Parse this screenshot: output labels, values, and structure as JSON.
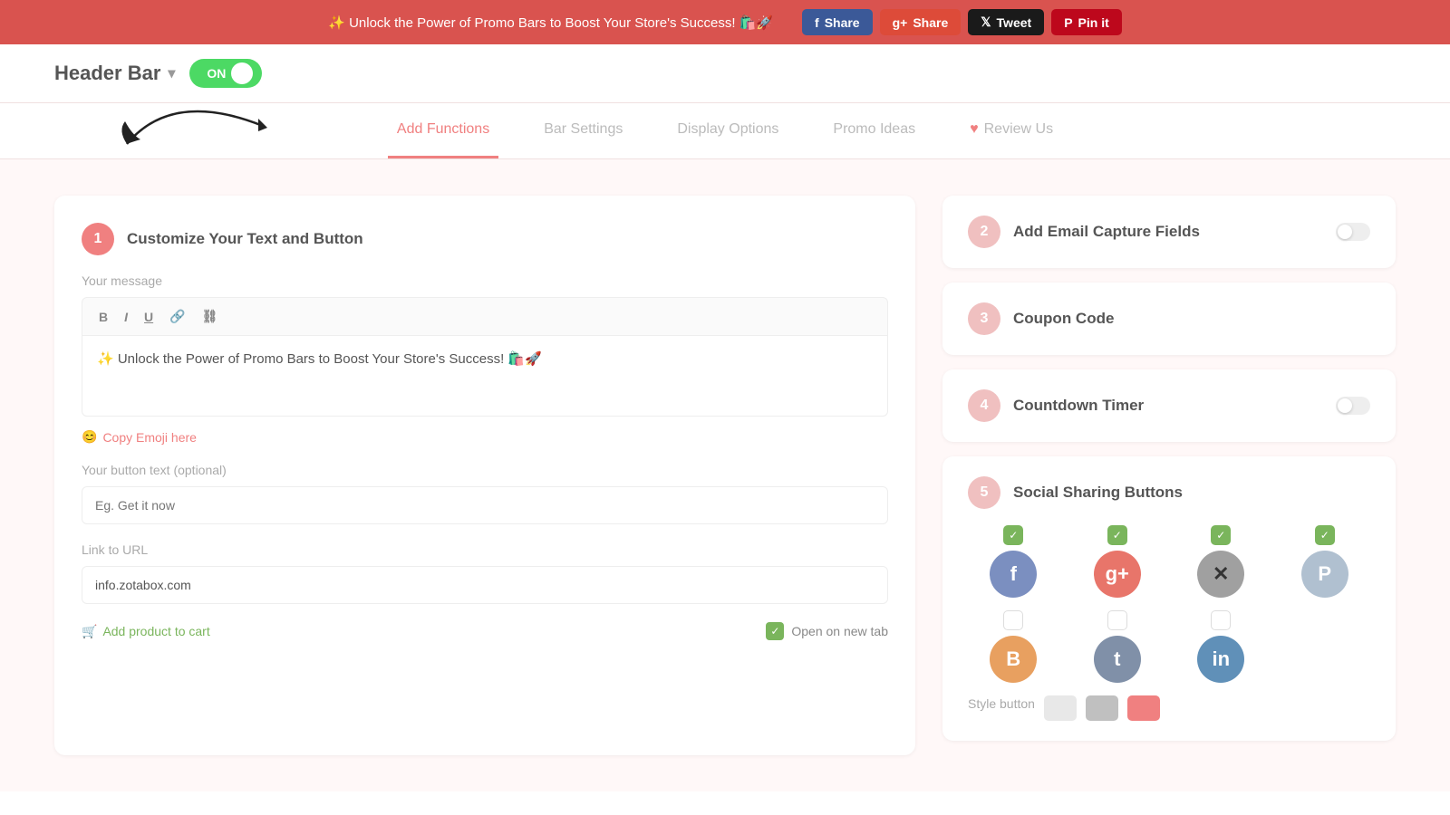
{
  "promo_banner": {
    "text": "✨ Unlock the Power of Promo Bars to Boost Your Store's Success! 🛍️🚀",
    "social_buttons": [
      {
        "id": "fb",
        "icon": "f",
        "label": "Share",
        "class": "fb"
      },
      {
        "id": "gp",
        "icon": "g+",
        "label": "Share",
        "class": "gp"
      },
      {
        "id": "tw",
        "icon": "𝕏",
        "label": "Tweet",
        "class": "tw"
      },
      {
        "id": "pin",
        "icon": "P",
        "label": "Pin it",
        "class": "pin"
      }
    ]
  },
  "header": {
    "title": "Header Bar",
    "toggle_label": "ON"
  },
  "nav": {
    "tabs": [
      {
        "id": "add-functions",
        "label": "Add Functions",
        "active": true
      },
      {
        "id": "bar-settings",
        "label": "Bar Settings",
        "active": false
      },
      {
        "id": "display-options",
        "label": "Display Options",
        "active": false
      },
      {
        "id": "promo-ideas",
        "label": "Promo Ideas",
        "active": false
      },
      {
        "id": "review-us",
        "label": "Review Us",
        "active": false
      }
    ]
  },
  "left_panel": {
    "step": "1",
    "title": "Customize Your Text and Button",
    "message_label": "Your message",
    "toolbar": {
      "bold": "B",
      "italic": "I",
      "underline": "U",
      "link": "🔗",
      "unlink": "⛓"
    },
    "message_text": "✨ Unlock the Power of Promo Bars to Boost Your Store's Success! 🛍️🚀",
    "emoji_label": "😊 Copy Emoji here",
    "button_text_label": "Your button text (optional)",
    "button_text_placeholder": "Eg. Get it now",
    "link_label": "Link to URL",
    "link_value": "info.zotabox.com",
    "add_product_label": "Add product to cart",
    "open_new_tab_label": "Open on new tab"
  },
  "right_panel": {
    "sections": [
      {
        "id": "email-capture",
        "step": "2",
        "title": "Add Email Capture Fields",
        "has_toggle": true
      },
      {
        "id": "coupon-code",
        "step": "3",
        "title": "Coupon Code",
        "has_toggle": false
      },
      {
        "id": "countdown-timer",
        "step": "4",
        "title": "Countdown Timer",
        "has_toggle": true
      },
      {
        "id": "social-sharing",
        "step": "5",
        "title": "Social Sharing Buttons",
        "has_toggle": false
      }
    ],
    "social_items": [
      {
        "id": "facebook",
        "icon": "f",
        "class": "fb-icon",
        "checked": true
      },
      {
        "id": "google-plus",
        "icon": "g+",
        "class": "gp-icon",
        "checked": true
      },
      {
        "id": "twitter",
        "icon": "✕",
        "class": "tw-icon",
        "checked": true
      },
      {
        "id": "pinterest",
        "icon": "P",
        "class": "pin-icon",
        "checked": true
      },
      {
        "id": "blogger",
        "icon": "B",
        "class": "blogger-icon",
        "checked": false
      },
      {
        "id": "tumblr",
        "icon": "t",
        "class": "tumblr-icon",
        "checked": false
      },
      {
        "id": "linkedin",
        "icon": "in",
        "class": "linkedin-icon",
        "checked": false
      }
    ],
    "style_button_label": "Style button",
    "swatches": [
      "#e8e8e8",
      "#c0c0c0",
      "#f08080"
    ]
  }
}
